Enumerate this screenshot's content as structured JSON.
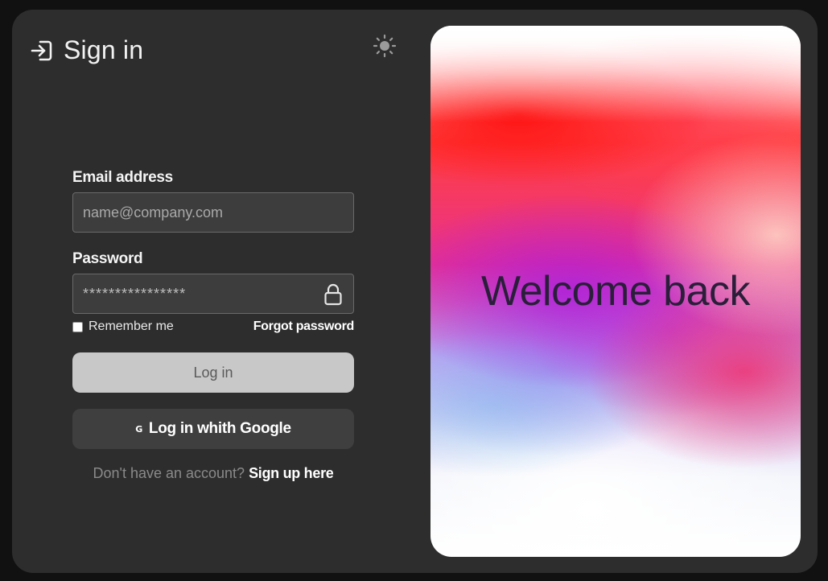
{
  "header": {
    "title": "Sign in",
    "icon": "sign-in-icon"
  },
  "theme_toggle": {
    "icon": "sun-icon"
  },
  "form": {
    "email_label": "Email address",
    "email_placeholder": "name@company.com",
    "email_value": "",
    "password_label": "Password",
    "password_value": "****************",
    "password_icon": "lock-icon",
    "remember_label": "Remember me",
    "remember_checked": false,
    "forgot_label": "Forgot password",
    "login_label": "Log in",
    "google_icon": "google-g-icon",
    "google_glyph": "G",
    "google_label": "Log in whith Google",
    "signup_prompt": "Don't have an account?",
    "signup_link": "Sign up here"
  },
  "hero": {
    "text": "Welcome back"
  },
  "colors": {
    "page_bg": "#111111",
    "card_bg": "#2d2d2d",
    "input_bg": "#3d3d3d",
    "login_button_bg": "#c8c8c8",
    "google_button_bg": "#3f3f3f",
    "hero_text": "#2a1e3a"
  }
}
